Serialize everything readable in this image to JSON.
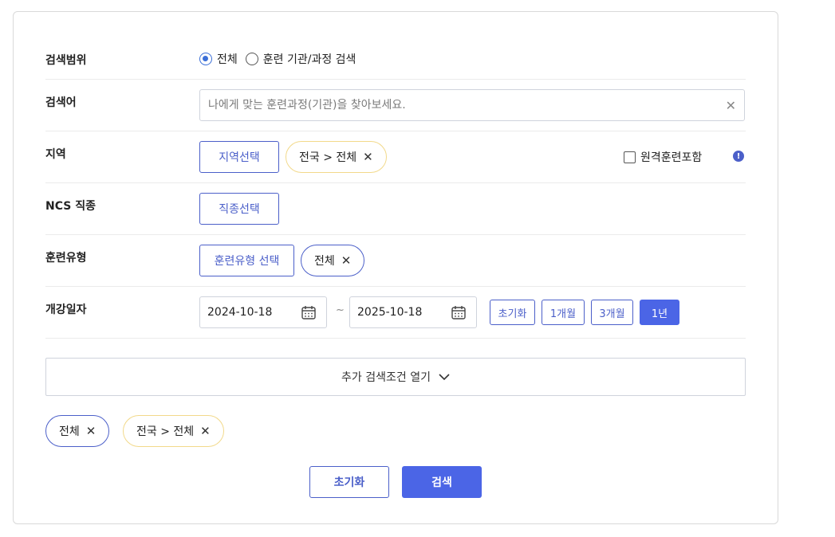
{
  "scope": {
    "label": "검색범위",
    "options": [
      "전체",
      "훈련 기관/과정 검색"
    ],
    "selected": "전체"
  },
  "keyword": {
    "label": "검색어",
    "placeholder": "나에게 맞는 훈련과정(기관)을 찾아보세요.",
    "value": "",
    "clear_icon": "close-icon"
  },
  "region": {
    "label": "지역",
    "select_button": "지역선택",
    "chip": "전국 > 전체",
    "remote_checkbox": "원격훈련포함",
    "remote_checked": false,
    "info_icon": "info-icon"
  },
  "ncs": {
    "label": "NCS 직종",
    "select_button": "직종선택"
  },
  "training_type": {
    "label": "훈련유형",
    "select_button": "훈련유형 선택",
    "chip": "전체"
  },
  "start_date": {
    "label": "개강일자",
    "from": "2024-10-18",
    "to": "2025-10-18",
    "separator": "~",
    "periods": [
      "초기화",
      "1개월",
      "3개월",
      "1년"
    ],
    "active_period": "1년"
  },
  "expand": {
    "label": "추가 검색조건 열기",
    "icon": "chevron-down-icon"
  },
  "selected_chips": [
    "전체",
    "전국 > 전체"
  ],
  "actions": {
    "reset": "초기화",
    "search": "검색"
  },
  "colors": {
    "accent": "#4b65e6",
    "accent_border": "#4b5fc9",
    "chip_yellow_border": "#f2d98a"
  }
}
